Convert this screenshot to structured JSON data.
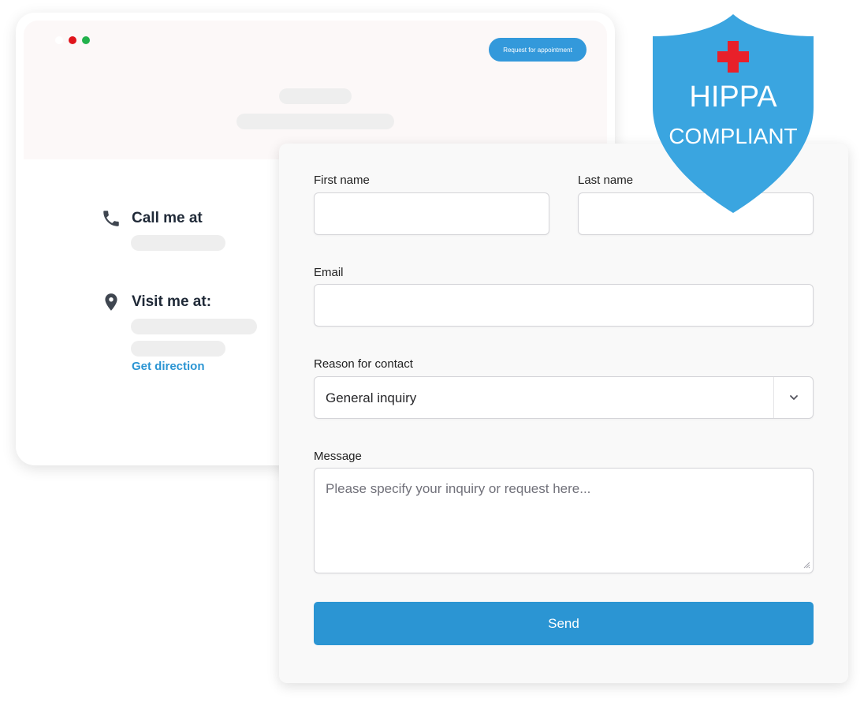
{
  "colors": {
    "accent": "#3399db",
    "send_button": "#2b95d3",
    "link": "#2b95d3",
    "shield": "#3aa5e0",
    "cross": "#e8202a",
    "dot_white": "#ffffff",
    "dot_red": "#e0141c",
    "dot_green": "#22b14c"
  },
  "browser": {
    "cta_label": "Request for appointment"
  },
  "contact_info": {
    "call_title": "Call me at",
    "visit_title": "Visit me at:",
    "get_direction": "Get direction",
    "icons": {
      "phone": "phone-icon",
      "location": "map-pin-icon"
    }
  },
  "form": {
    "first_name_label": "First name",
    "last_name_label": "Last name",
    "email_label": "Email",
    "reason_label": "Reason for contact",
    "reason_value": "General inquiry",
    "message_label": "Message",
    "message_placeholder": "Please specify your inquiry or request here...",
    "send_label": "Send"
  },
  "badge": {
    "line1": "HIPPA",
    "line2": "COMPLIANT"
  }
}
